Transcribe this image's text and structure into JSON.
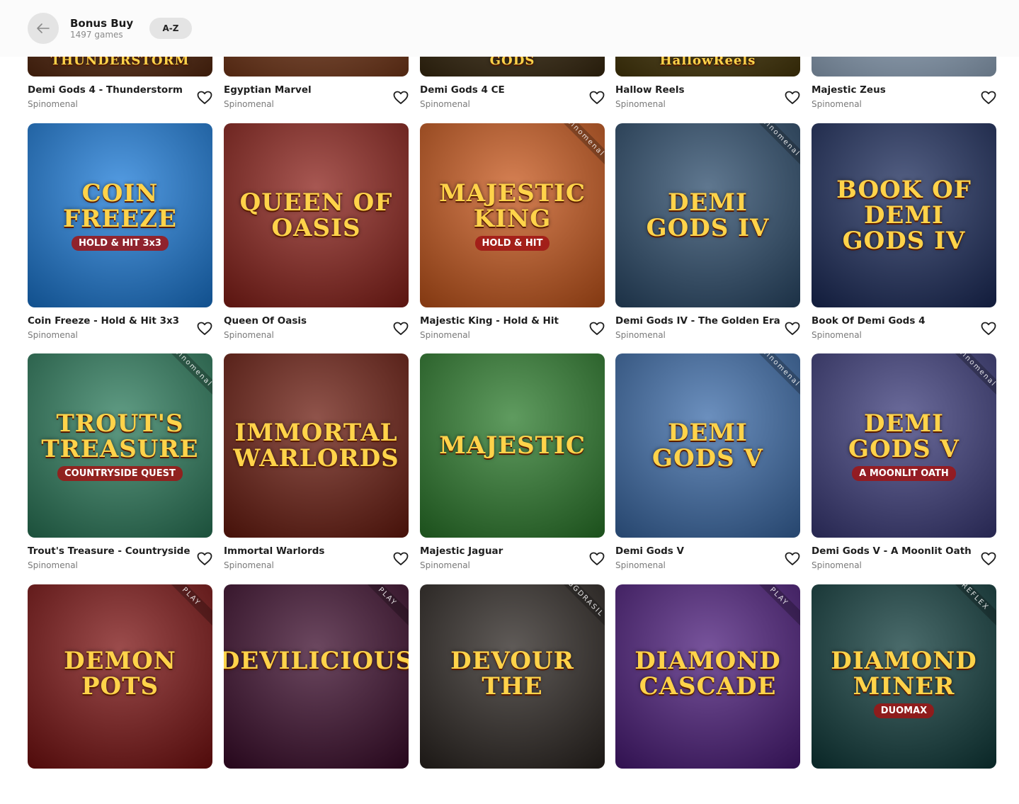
{
  "header": {
    "title": "Bonus Buy",
    "subtitle": "1497 games",
    "sort_label": "A-Z"
  },
  "rows": [
    {
      "games": [
        {
          "name": "Demi Gods 4 - Thunderstorm",
          "provider": "Spinomenal",
          "art_title": "THUNDERSTORM",
          "art_sub": "",
          "badge": "",
          "bg": "#5a2a10"
        },
        {
          "name": "Egyptian Marvel",
          "provider": "Spinomenal",
          "art_title": "",
          "art_sub": "",
          "badge": "",
          "bg": "#7a3a1a"
        },
        {
          "name": "Demi Gods 4 CE",
          "provider": "Spinomenal",
          "art_title": "GODS",
          "art_sub": "",
          "badge": "",
          "bg": "#3a2a10"
        },
        {
          "name": "Hallow Reels",
          "provider": "Spinomenal",
          "art_title": "HallowReels",
          "art_sub": "",
          "badge": "",
          "bg": "#4a3a0a"
        },
        {
          "name": "Majestic Zeus",
          "provider": "Spinomenal",
          "art_title": "",
          "art_sub": "",
          "badge": "",
          "bg": "#9ab0c8"
        }
      ]
    },
    {
      "games": [
        {
          "name": "Coin Freeze - Hold & Hit 3x3",
          "provider": "Spinomenal",
          "art_title": "COIN FREEZE",
          "art_sub": "HOLD & HIT 3x3",
          "badge": "",
          "bg": "#1a7ad8"
        },
        {
          "name": "Queen Of Oasis",
          "provider": "Spinomenal",
          "art_title": "QUEEN OF OASIS",
          "art_sub": "",
          "badge": "",
          "bg": "#8a1f18"
        },
        {
          "name": "Majestic King - Hold & Hit",
          "provider": "Spinomenal",
          "art_title": "MAJESTIC KING",
          "art_sub": "HOLD & HIT",
          "badge": "Spinomenal",
          "bg": "#c8561a"
        },
        {
          "name": "Demi Gods IV - The Golden Era",
          "provider": "Spinomenal",
          "art_title": "DEMI GODS IV",
          "art_sub": "",
          "badge": "Spinomenal",
          "bg": "#2a4a6a"
        },
        {
          "name": "Book Of Demi Gods 4",
          "provider": "Spinomenal",
          "art_title": "BOOK OF DEMI GODS IV",
          "art_sub": "",
          "badge": "",
          "bg": "#1a2a5a"
        }
      ]
    },
    {
      "games": [
        {
          "name": "Trout's Treasure - Countryside Quest",
          "provider": "Spinomenal",
          "art_title": "TROUT'S TREASURE",
          "art_sub": "COUNTRYSIDE QUEST",
          "badge": "Spinomenal",
          "bg": "#2a7a5a"
        },
        {
          "name": "Immortal Warlords",
          "provider": "Spinomenal",
          "art_title": "IMMORTAL WARLORDS",
          "art_sub": "",
          "badge": "",
          "bg": "#6a1a0e"
        },
        {
          "name": "Majestic Jaguar",
          "provider": "Spinomenal",
          "art_title": "MAJESTIC",
          "art_sub": "",
          "badge": "",
          "bg": "#2a7a2a"
        },
        {
          "name": "Demi Gods V",
          "provider": "Spinomenal",
          "art_title": "DEMI GODS V",
          "art_sub": "",
          "badge": "Spinomenal",
          "bg": "#3a6aa8"
        },
        {
          "name": "Demi Gods V - A Moonlit Oath",
          "provider": "Spinomenal",
          "art_title": "DEMI GODS V",
          "art_sub": "A MOONLIT OATH",
          "badge": "Spinomenal",
          "bg": "#3a3a7a"
        }
      ]
    },
    {
      "games": [
        {
          "name": "",
          "provider": "",
          "art_title": "DEMON POTS",
          "art_sub": "",
          "badge": "PLAY",
          "bg": "#7a1010"
        },
        {
          "name": "",
          "provider": "",
          "art_title": "DEVILICIOUS",
          "art_sub": "",
          "badge": "PLAY",
          "bg": "#3a0a2a"
        },
        {
          "name": "",
          "provider": "",
          "art_title": "DEVOUR THE",
          "art_sub": "",
          "badge": "YGGDRASIL",
          "bg": "#2a2420"
        },
        {
          "name": "",
          "provider": "",
          "art_title": "DIAMOND CASCADE",
          "art_sub": "",
          "badge": "PLAY",
          "bg": "#4a1a7a"
        },
        {
          "name": "",
          "provider": "",
          "art_title": "DIAMOND MINER",
          "art_sub": "DUOMAX",
          "badge": "REFLEX",
          "bg": "#0e3a3a"
        }
      ]
    }
  ]
}
